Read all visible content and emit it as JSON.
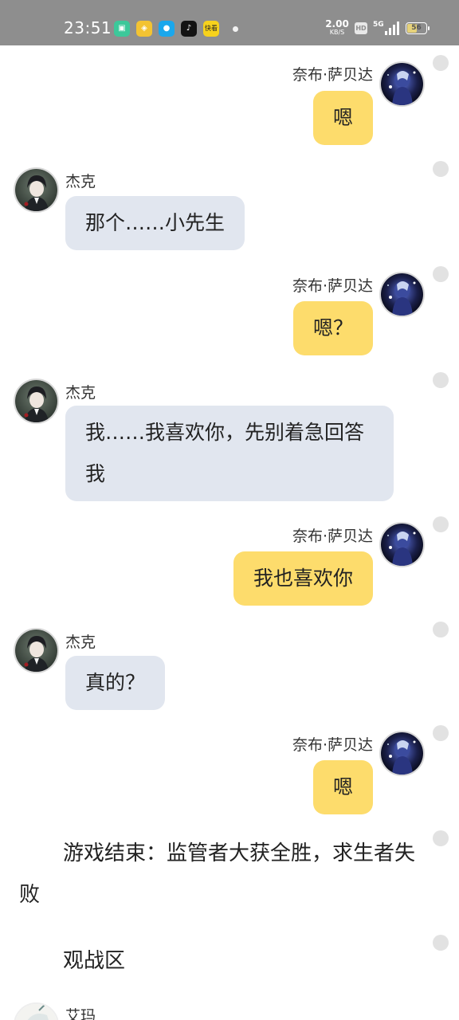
{
  "status_bar": {
    "time": "23:51",
    "apps": [
      {
        "name": "green-app-icon",
        "glyph": "▣",
        "color": "#3cc89a"
      },
      {
        "name": "yellow-app-icon",
        "glyph": "◈",
        "color": "#f3c332"
      },
      {
        "name": "blue-app-icon",
        "glyph": "●",
        "color": "#1aa7ec"
      },
      {
        "name": "tiktok-icon",
        "glyph": "♪",
        "color": "#121212"
      },
      {
        "name": "kuaikan-icon",
        "glyph": "快看",
        "color": "#f7d21c"
      }
    ],
    "net_speed": "2.00",
    "net_unit": "KB/S",
    "hd": "HD",
    "network": "5G",
    "battery": "56",
    "battery_level": 0.56
  },
  "messages": [
    {
      "type": "right",
      "name": "奈布·萨贝达",
      "text": "嗯"
    },
    {
      "type": "left",
      "name": "杰克",
      "text": "那个……小先生"
    },
    {
      "type": "right",
      "name": "奈布·萨贝达",
      "text": "嗯？"
    },
    {
      "type": "left",
      "name": "杰克",
      "text": "我……我喜欢你，先别着急回答我"
    },
    {
      "type": "right",
      "name": "奈布·萨贝达",
      "text": "我也喜欢你"
    },
    {
      "type": "left",
      "name": "杰克",
      "text": "真的？"
    },
    {
      "type": "right",
      "name": "奈布·萨贝达",
      "text": "嗯"
    },
    {
      "type": "system",
      "text": "游戏结束：监管者大获全胜，求生者失败"
    },
    {
      "type": "system",
      "text": "观战区"
    },
    {
      "type": "left",
      "name": "艾玛",
      "text": ""
    }
  ]
}
